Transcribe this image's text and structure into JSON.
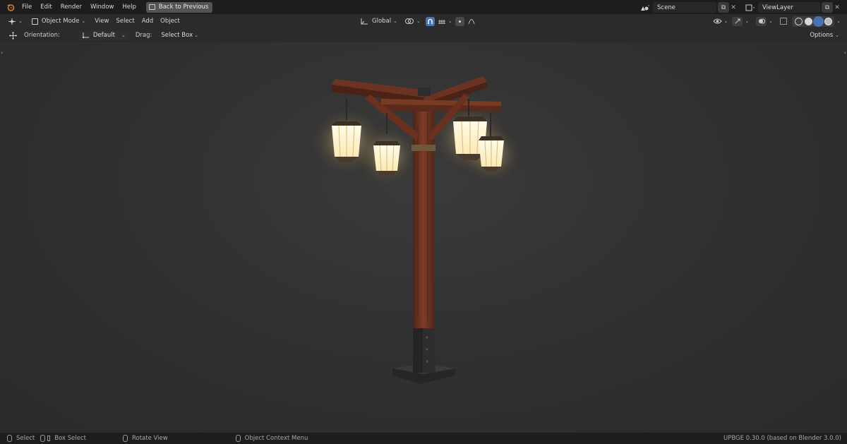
{
  "topbar": {
    "menu": [
      "File",
      "Edit",
      "Render",
      "Window",
      "Help"
    ],
    "back_button": "Back to Previous",
    "scene_value": "Scene",
    "view_layer_value": "ViewLayer"
  },
  "header": {
    "mode": "Object Mode",
    "menus": [
      "View",
      "Select",
      "Add",
      "Object"
    ],
    "transform_orientation": "Global"
  },
  "tool_settings": {
    "orientation_label": "Orientation:",
    "orientation_value": "Default",
    "drag_label": "Drag:",
    "drag_value": "Select Box",
    "options_label": "Options"
  },
  "statusbar": {
    "select": "Select",
    "box_select": "Box Select",
    "rotate_view": "Rotate View",
    "context_menu": "Object Context Menu",
    "version": "UPBGE 0.30.0 (based on Blender 3.0.0)"
  },
  "colors": {
    "accent_blue": "#4772b3",
    "lamp_glow": "#fff2c8",
    "wood": "#7a3b25"
  }
}
